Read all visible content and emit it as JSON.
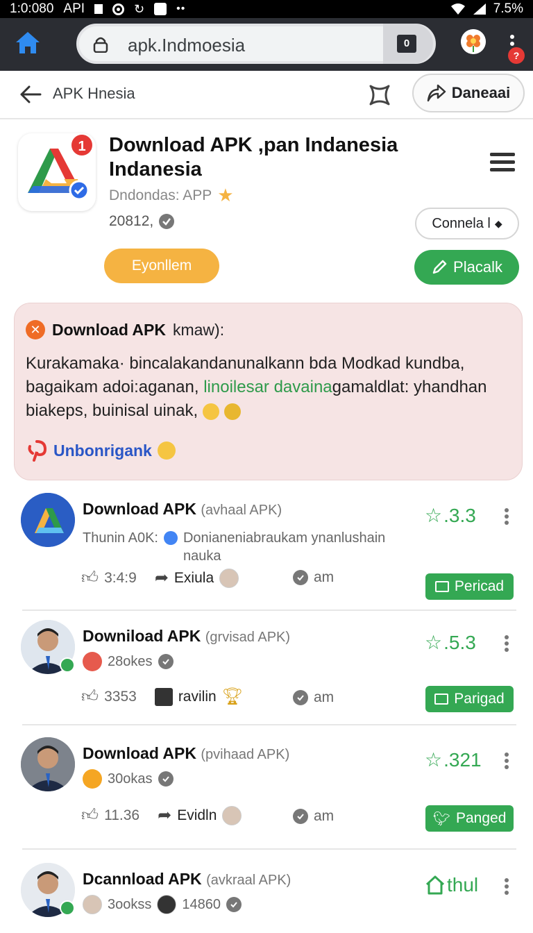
{
  "status_bar": {
    "time": "1:0:080",
    "carrier": "API",
    "battery": "7.5%"
  },
  "browser": {
    "url": "apk.Indmoesia",
    "tab_count": "0",
    "notification_badge": "?"
  },
  "app_header": {
    "title": "APK Hnesia",
    "download_label": "Daneaai"
  },
  "app": {
    "icon_badge": "1",
    "title": "Download APK ,pan Indanesia Indanesia",
    "developer": "Dndondas: APP",
    "meta": "20812,",
    "connect_label": "Connela l",
    "yellow_button": "Eyonllem",
    "green_button": "Placalk"
  },
  "notice": {
    "heading": "Download APK",
    "heading_suffix": "kmaw):",
    "body_part1": "Kurakamaka· bincalakandanunalkann bda Modkad kundba, bagaikam adoi:aganan, ",
    "body_link": "linoilesar davaina",
    "body_part2": "gamaldlat: yhandhan biakeps, buinisal uinak,",
    "link_label": "Unbonrigank"
  },
  "items": [
    {
      "title": "Download APK",
      "title_sub": "(avhaal APK)",
      "sub_prefix": "Thunin A0K:",
      "sub_text": "Donianeniabraukam ynanlushain nauka",
      "rating": ".3.3",
      "likes": "3:4:9",
      "share_label": "Exiula",
      "am": "am",
      "tag": "Pericad"
    },
    {
      "title": "Downiload APK",
      "title_sub": "(grvisad APK)",
      "sub_text": "28okes",
      "rating": ".5.3",
      "likes": "3353",
      "share_label": "ravilin",
      "am": "am",
      "tag": "Parigad"
    },
    {
      "title": "Download APK",
      "title_sub": "(pvihaad APK)",
      "sub_text": "30okas",
      "rating": ".321",
      "likes": "11.36",
      "share_label": "Evidln",
      "am": "am",
      "tag": "Panged"
    },
    {
      "title": "Dcannload APK",
      "title_sub": "(avkraal APK)",
      "sub_text": "3ookss",
      "sub_text2": "14860",
      "rating": "thul"
    }
  ],
  "colors": {
    "accent_green": "#34a853",
    "accent_yellow": "#f5b342",
    "notice_bg": "#f6e4e4",
    "link_blue": "#2a56c6"
  }
}
